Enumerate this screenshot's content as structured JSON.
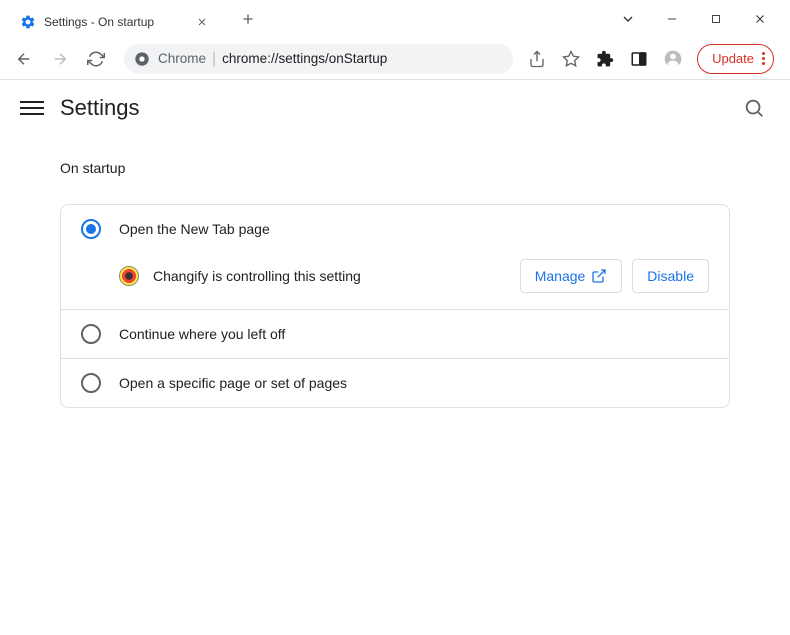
{
  "window": {
    "tab_title": "Settings - On startup"
  },
  "address": {
    "prefix": "Chrome",
    "url": "chrome://settings/onStartup"
  },
  "toolbar": {
    "update_label": "Update"
  },
  "header": {
    "title": "Settings"
  },
  "section": {
    "title": "On startup"
  },
  "options": {
    "new_tab": "Open the New Tab page",
    "continue": "Continue where you left off",
    "specific": "Open a specific page or set of pages"
  },
  "extension": {
    "notice": "Changify is controlling this setting",
    "manage": "Manage",
    "disable": "Disable"
  }
}
